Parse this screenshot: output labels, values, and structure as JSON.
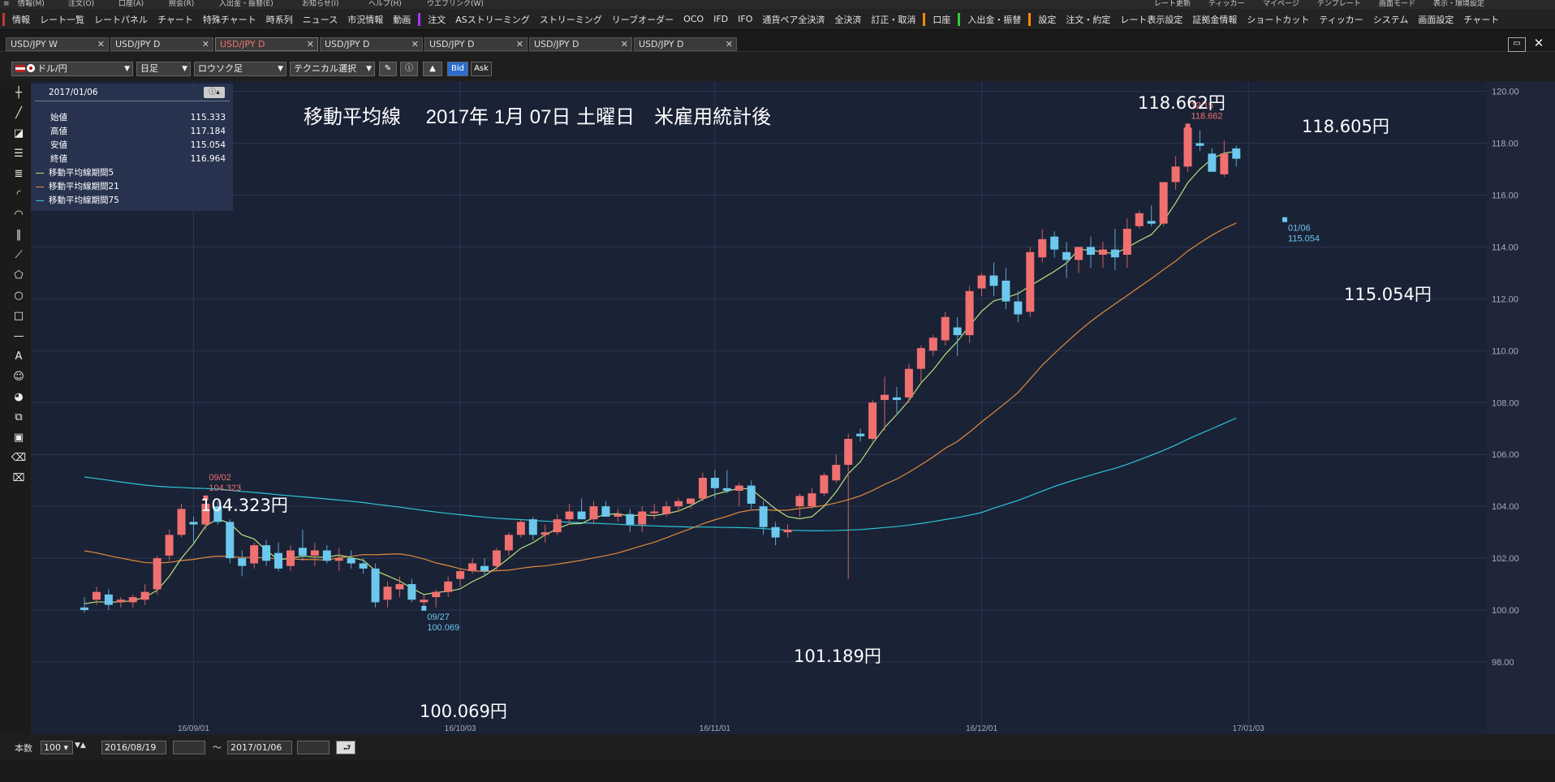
{
  "menubar": {
    "items": [
      "情報(M)",
      "注文(O)",
      "口座(A)",
      "照会(R)",
      "入出金・振替(E)",
      "お知らせ(I)",
      "ヘルプ(H)",
      "ウエブリンク(W)"
    ],
    "right_items": [
      "レート更新",
      "ティッカー",
      "マイページ",
      "テンプレート",
      "画面モード",
      "表示・環境設定"
    ]
  },
  "toolbar": {
    "items": [
      "情報",
      "レート一覧",
      "レートパネル",
      "チャート",
      "特殊チャート",
      "時系列",
      "ニュース",
      "市況情報",
      "動画",
      "注文",
      "ASストリーミング",
      "ストリーミング",
      "リーブオーダー",
      "OCO",
      "IFD",
      "IFO",
      "通貨ペア全決済",
      "全決済",
      "訂正・取消",
      "口座",
      "入出金・振替",
      "設定",
      "注文・約定",
      "レート表示設定",
      "証拠金情報",
      "ショートカット",
      "ティッカー",
      "システム",
      "画面設定",
      "チャート"
    ]
  },
  "tabs": [
    {
      "label": "USD/JPY W",
      "active": false
    },
    {
      "label": "USD/JPY D",
      "active": false
    },
    {
      "label": "USD/JPY D",
      "active": true
    },
    {
      "label": "USD/JPY D",
      "active": false
    },
    {
      "label": "USD/JPY D",
      "active": false
    },
    {
      "label": "USD/JPY D",
      "active": false
    },
    {
      "label": "USD/JPY D",
      "active": false
    }
  ],
  "chart_toolbar": {
    "currency": "ドル/円",
    "period": "日足",
    "chart_style": "ロウソク足",
    "technical": "テクニカル選択",
    "bid": "Bid",
    "ask": "Ask"
  },
  "info_panel": {
    "date": "2017/01/06",
    "rows": [
      {
        "label": "始値",
        "value": "115.333"
      },
      {
        "label": "高値",
        "value": "117.184"
      },
      {
        "label": "安値",
        "value": "115.054"
      },
      {
        "label": "終値",
        "value": "116.964"
      }
    ],
    "ma": [
      {
        "label": "移動平均線期間5",
        "color": "#b9e07c"
      },
      {
        "label": "移動平均線期間21",
        "color": "#e08a3c"
      },
      {
        "label": "移動平均線期間75",
        "color": "#2ec4d6"
      }
    ]
  },
  "annotations": {
    "title": "移動平均線　 2017年 1月 07日 土曜日　米雇用統計後",
    "a1": "104.323円",
    "a2": "100.069円",
    "a3": "101.189円",
    "a4": "118.662円",
    "a5": "118.605円",
    "a6": "115.054円",
    "m1_date": "09/02",
    "m1_val": "104.323",
    "m2_date": "09/27",
    "m2_val": "100.069",
    "m3_date": "12/15",
    "m3_val": "118.662",
    "m4_date": "01/06",
    "m4_val": "115.054"
  },
  "colors": {
    "bg": "#1a2236",
    "up": "#f07070",
    "down": "#6cc8ec",
    "ma5": "#b9e07c",
    "ma21": "#e08a3c",
    "ma75": "#2ec4d6"
  },
  "chart_data": {
    "type": "candlestick",
    "series_name": "USD/JPY",
    "ylim": [
      98,
      120
    ],
    "yticks": [
      "98.00",
      "100.00",
      "102.00",
      "104.00",
      "106.00",
      "108.00",
      "110.00",
      "112.00",
      "114.00",
      "116.00",
      "118.00",
      "120.00"
    ],
    "xticks": [
      {
        "label": "16/09/01",
        "index": 9
      },
      {
        "label": "16/10/03",
        "index": 31
      },
      {
        "label": "16/11/01",
        "index": 52
      },
      {
        "label": "16/12/01",
        "index": 74
      },
      {
        "label": "17/01/03",
        "index": 96
      }
    ],
    "candles": [
      [
        100.1,
        100.5,
        99.9,
        100.0
      ],
      [
        100.4,
        100.9,
        100.2,
        100.7
      ],
      [
        100.6,
        100.8,
        100.0,
        100.2
      ],
      [
        100.3,
        100.5,
        100.1,
        100.4
      ],
      [
        100.3,
        100.6,
        100.1,
        100.5
      ],
      [
        100.4,
        101.0,
        100.2,
        100.7
      ],
      [
        100.8,
        102.1,
        100.6,
        102.0
      ],
      [
        102.1,
        103.1,
        101.9,
        102.9
      ],
      [
        102.9,
        104.1,
        102.8,
        103.9
      ],
      [
        103.4,
        103.6,
        102.6,
        103.3
      ],
      [
        103.3,
        104.3,
        103.1,
        104.1
      ],
      [
        104.0,
        104.2,
        103.3,
        103.4
      ],
      [
        103.4,
        103.5,
        101.8,
        102.0
      ],
      [
        102.0,
        102.3,
        101.3,
        101.7
      ],
      [
        101.8,
        102.6,
        101.6,
        102.5
      ],
      [
        102.5,
        102.7,
        101.7,
        101.9
      ],
      [
        102.2,
        102.6,
        101.5,
        101.6
      ],
      [
        101.7,
        102.5,
        101.5,
        102.3
      ],
      [
        102.4,
        103.1,
        101.9,
        102.1
      ],
      [
        102.1,
        102.6,
        101.7,
        102.3
      ],
      [
        102.3,
        102.5,
        101.8,
        101.9
      ],
      [
        101.9,
        102.4,
        101.5,
        102.0
      ],
      [
        102.0,
        102.3,
        101.6,
        101.8
      ],
      [
        101.8,
        102.0,
        101.4,
        101.6
      ],
      [
        101.6,
        101.8,
        100.1,
        100.3
      ],
      [
        100.4,
        101.1,
        100.1,
        100.9
      ],
      [
        100.8,
        101.3,
        100.5,
        101.0
      ],
      [
        101.0,
        101.2,
        100.3,
        100.4
      ],
      [
        100.3,
        100.6,
        100.0,
        100.4
      ],
      [
        100.5,
        100.8,
        100.1,
        100.7
      ],
      [
        100.7,
        101.3,
        100.5,
        101.1
      ],
      [
        101.2,
        101.6,
        100.9,
        101.5
      ],
      [
        101.5,
        102.0,
        101.4,
        101.8
      ],
      [
        101.7,
        102.0,
        101.3,
        101.5
      ],
      [
        101.7,
        102.4,
        101.5,
        102.3
      ],
      [
        102.3,
        103.0,
        102.1,
        102.9
      ],
      [
        102.9,
        103.5,
        102.8,
        103.4
      ],
      [
        103.5,
        103.6,
        102.7,
        102.9
      ],
      [
        102.9,
        103.3,
        102.6,
        103.0
      ],
      [
        103.0,
        103.7,
        102.9,
        103.5
      ],
      [
        103.5,
        104.1,
        103.3,
        103.8
      ],
      [
        103.8,
        104.3,
        103.5,
        103.5
      ],
      [
        103.5,
        104.2,
        103.3,
        104.0
      ],
      [
        104.0,
        104.2,
        103.6,
        103.6
      ],
      [
        103.6,
        103.9,
        103.4,
        103.7
      ],
      [
        103.7,
        103.9,
        103.0,
        103.3
      ],
      [
        103.3,
        104.0,
        103.0,
        103.8
      ],
      [
        103.8,
        104.1,
        103.5,
        103.8
      ],
      [
        103.7,
        104.2,
        103.6,
        104.0
      ],
      [
        104.0,
        104.3,
        103.8,
        104.2
      ],
      [
        104.1,
        104.3,
        103.9,
        104.3
      ],
      [
        104.3,
        105.3,
        104.2,
        105.1
      ],
      [
        105.1,
        105.4,
        104.3,
        104.7
      ],
      [
        104.7,
        105.4,
        104.5,
        104.6
      ],
      [
        104.6,
        104.9,
        104.0,
        104.8
      ],
      [
        104.8,
        105.0,
        103.9,
        104.1
      ],
      [
        104.0,
        104.2,
        102.9,
        103.2
      ],
      [
        103.2,
        103.4,
        102.5,
        102.8
      ],
      [
        103.0,
        103.3,
        102.8,
        103.1
      ],
      [
        104.0,
        104.5,
        103.6,
        104.4
      ],
      [
        104.0,
        104.7,
        103.9,
        104.5
      ],
      [
        104.5,
        105.3,
        104.4,
        105.2
      ],
      [
        105.0,
        106.0,
        104.9,
        105.6
      ],
      [
        105.6,
        106.8,
        101.189,
        106.6
      ],
      [
        106.8,
        107.0,
        106.5,
        106.7
      ],
      [
        106.6,
        108.1,
        106.5,
        108.0
      ],
      [
        108.1,
        109.0,
        106.9,
        108.3
      ],
      [
        108.2,
        108.6,
        107.6,
        108.1
      ],
      [
        108.2,
        109.5,
        108.0,
        109.3
      ],
      [
        109.3,
        110.2,
        108.8,
        110.1
      ],
      [
        110.0,
        110.6,
        109.8,
        110.5
      ],
      [
        110.4,
        111.5,
        110.2,
        111.3
      ],
      [
        110.9,
        111.3,
        109.8,
        110.6
      ],
      [
        110.6,
        112.5,
        110.3,
        112.3
      ],
      [
        112.4,
        113.0,
        112.1,
        112.9
      ],
      [
        112.9,
        113.4,
        112.1,
        112.5
      ],
      [
        112.7,
        113.2,
        111.6,
        111.9
      ],
      [
        111.9,
        112.3,
        111.1,
        111.4
      ],
      [
        111.5,
        114.0,
        111.3,
        113.8
      ],
      [
        113.6,
        114.7,
        113.4,
        114.3
      ],
      [
        114.4,
        114.6,
        113.6,
        113.9
      ],
      [
        113.8,
        114.2,
        112.8,
        113.5
      ],
      [
        113.5,
        114.0,
        113.0,
        114.0
      ],
      [
        114.0,
        114.4,
        113.2,
        113.7
      ],
      [
        113.7,
        114.2,
        113.2,
        113.9
      ],
      [
        113.9,
        114.7,
        113.1,
        113.6
      ],
      [
        113.7,
        115.1,
        113.2,
        114.7
      ],
      [
        114.8,
        115.4,
        114.7,
        115.3
      ],
      [
        115.0,
        115.6,
        114.8,
        114.9
      ],
      [
        114.9,
        115.8,
        114.8,
        116.5
      ],
      [
        116.5,
        117.5,
        116.2,
        117.1
      ],
      [
        117.1,
        118.662,
        116.9,
        118.6
      ],
      [
        118.0,
        118.5,
        117.7,
        117.9
      ],
      [
        117.6,
        117.8,
        116.9,
        116.9
      ],
      [
        116.8,
        118.1,
        116.7,
        117.6
      ],
      [
        117.8,
        117.9,
        117.1,
        117.4
      ]
    ]
  }
}
